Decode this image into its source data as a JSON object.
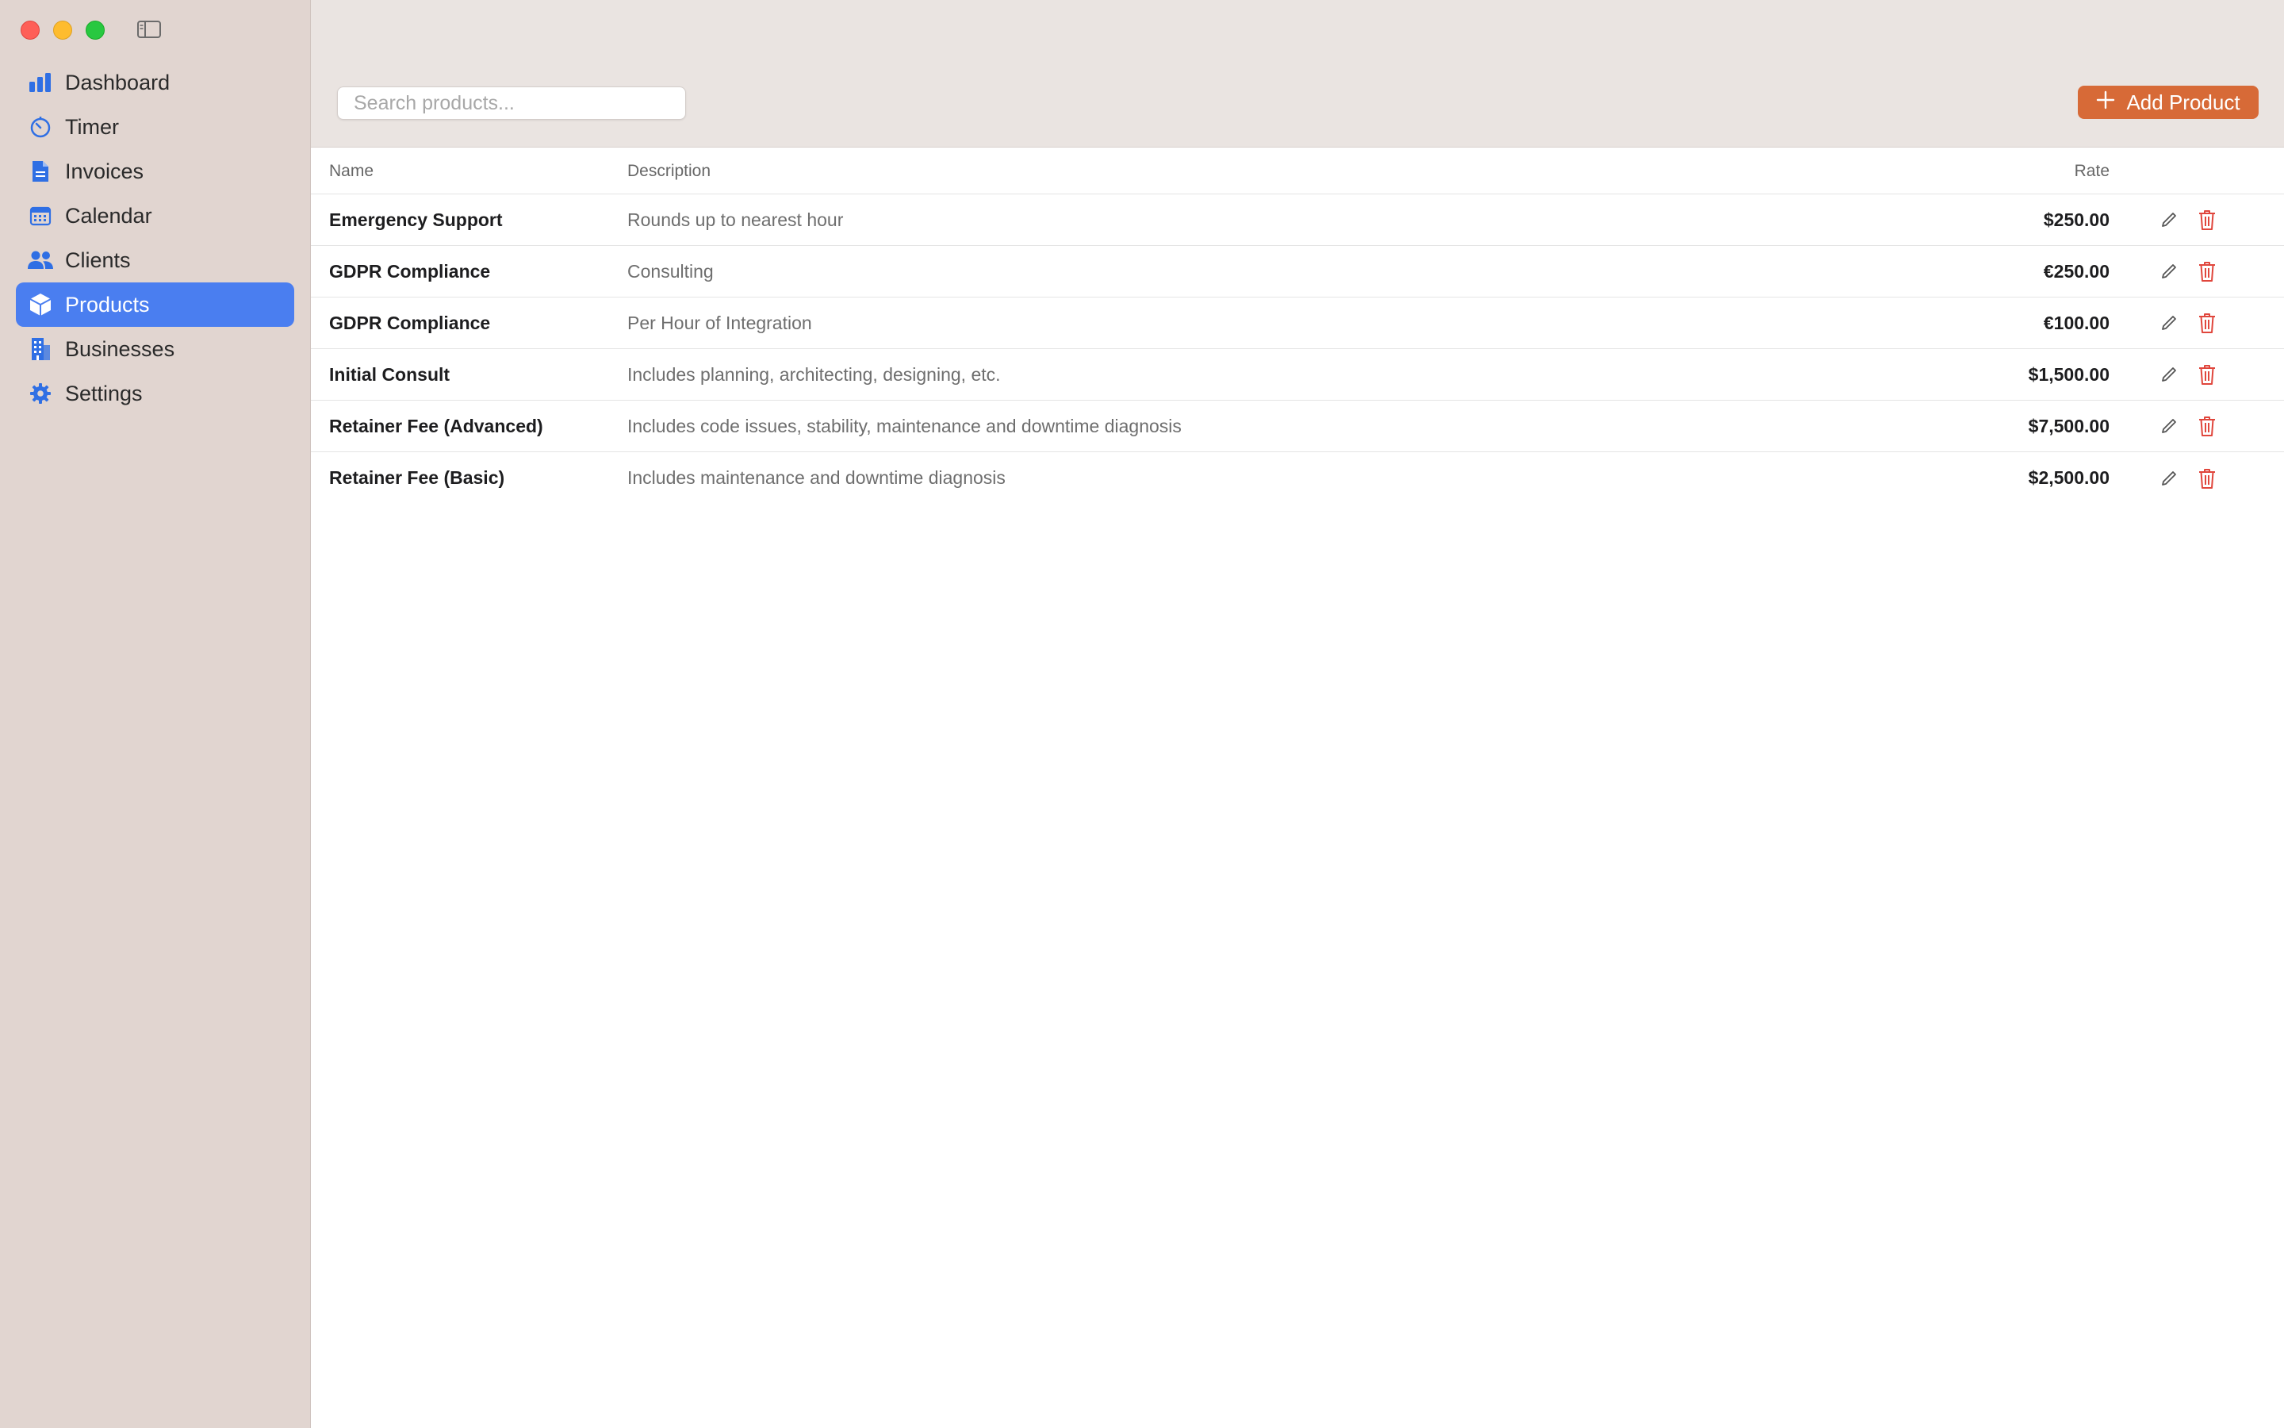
{
  "colors": {
    "accent": "#4a7ef0",
    "add_button": "#d76a37",
    "delete": "#e0463c",
    "sidebar_bg": "#e1d5d0",
    "toolbar_bg": "#eae4e1"
  },
  "sidebar": {
    "items": [
      {
        "label": "Dashboard",
        "icon": "bar-chart-icon",
        "active": false
      },
      {
        "label": "Timer",
        "icon": "timer-icon",
        "active": false
      },
      {
        "label": "Invoices",
        "icon": "document-icon",
        "active": false
      },
      {
        "label": "Calendar",
        "icon": "calendar-icon",
        "active": false
      },
      {
        "label": "Clients",
        "icon": "people-icon",
        "active": false
      },
      {
        "label": "Products",
        "icon": "cube-icon",
        "active": true
      },
      {
        "label": "Businesses",
        "icon": "building-icon",
        "active": false
      },
      {
        "label": "Settings",
        "icon": "gear-icon",
        "active": false
      }
    ]
  },
  "toolbar": {
    "search_placeholder": "Search products...",
    "add_label": "Add Product"
  },
  "table": {
    "headers": {
      "name": "Name",
      "description": "Description",
      "rate": "Rate"
    },
    "rows": [
      {
        "name": "Emergency Support",
        "description": "Rounds up to nearest hour",
        "rate": "$250.00"
      },
      {
        "name": "GDPR Compliance",
        "description": "Consulting",
        "rate": "€250.00"
      },
      {
        "name": "GDPR Compliance",
        "description": "Per Hour of Integration",
        "rate": "€100.00"
      },
      {
        "name": "Initial Consult",
        "description": "Includes planning, architecting, designing, etc.",
        "rate": "$1,500.00"
      },
      {
        "name": "Retainer Fee (Advanced)",
        "description": "Includes code issues, stability, maintenance and downtime diagnosis",
        "rate": "$7,500.00"
      },
      {
        "name": "Retainer Fee (Basic)",
        "description": "Includes maintenance and downtime diagnosis",
        "rate": "$2,500.00"
      }
    ]
  }
}
